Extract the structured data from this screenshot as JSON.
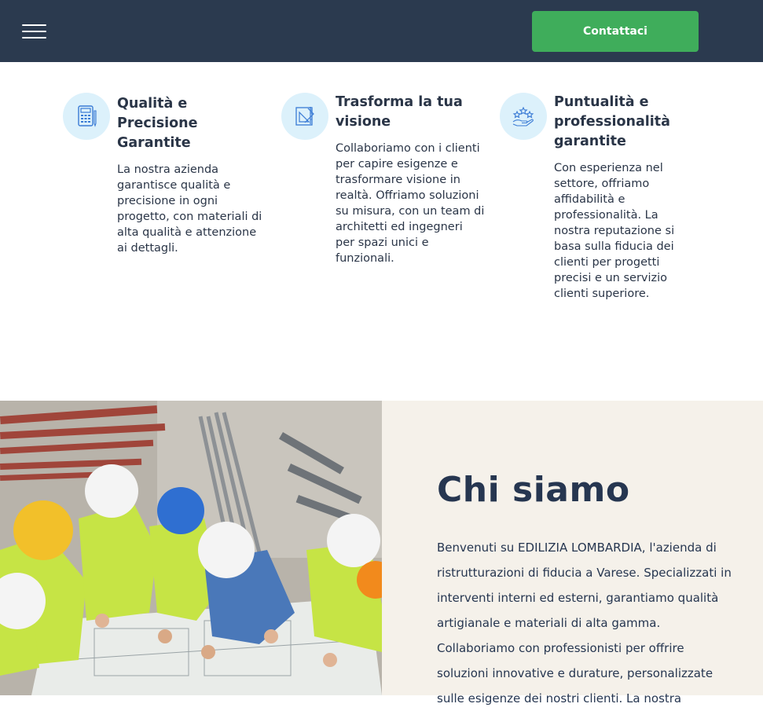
{
  "header": {
    "menu_icon": "hamburger-menu-icon",
    "cta_label": "Contattaci",
    "background": "#2b3a4f",
    "cta_color": "#3fad5b"
  },
  "features": [
    {
      "icon": "calculator-icon",
      "title": "Qualità e Precisione Garantite",
      "text": "La nostra azienda garantisce qualità e precisione in ogni progetto, con materiali di alta qualità e attenzione ai dettagli."
    },
    {
      "icon": "blueprint-ruler-icon",
      "title": "Trasforma la tua visione",
      "text": "Collaboriamo con i clienti per capire esigenze e trasformare visione in realtà. Offriamo soluzioni su misura, con un team di architetti ed ingegneri per spazi unici e funzionali."
    },
    {
      "icon": "rating-stars-hand-icon",
      "title": "Puntualità e professionalità garantite",
      "text": "Con esperienza nel settore, offriamo affidabilità e professionalità. La nostra reputazione si basa sulla fiducia dei clienti per progetti precisi e un servizio clienti superiore."
    }
  ],
  "about": {
    "title": "Chi siamo",
    "text": "Benvenuti su EDILIZIA LOMBARDIA, l'azienda di ristrutturazioni di fiducia a Varese. Specializzati in interventi interni ed esterni, garantiamo qualità artigianale e materiali di alta gamma. Collaboriamo con professionisti per offrire soluzioni innovative e durature, personalizzate sulle esigenze dei nostri clienti. La nostra",
    "image": "construction-workers-reviewing-blueprints-photo",
    "background": "#f5f1ea"
  }
}
